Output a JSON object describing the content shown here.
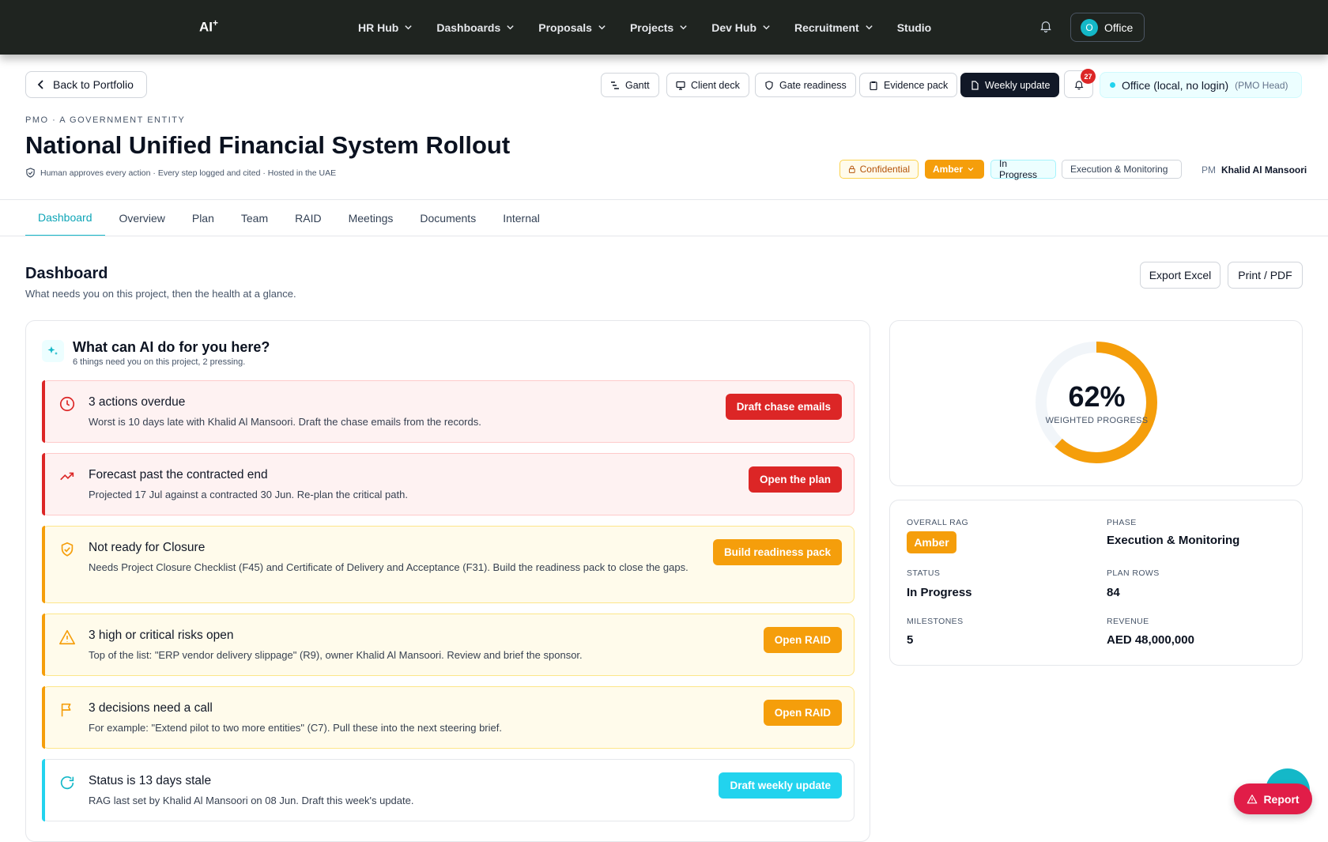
{
  "app": {
    "logo": "AI",
    "logo_sup": "+"
  },
  "nav": {
    "items": [
      {
        "label": "HR Hub",
        "dropdown": true
      },
      {
        "label": "Dashboards",
        "dropdown": true
      },
      {
        "label": "Proposals",
        "dropdown": true
      },
      {
        "label": "Projects",
        "dropdown": true
      },
      {
        "label": "Dev Hub",
        "dropdown": true
      },
      {
        "label": "Recruitment",
        "dropdown": true
      },
      {
        "label": "Studio",
        "dropdown": false
      }
    ],
    "user_initial": "O",
    "user_label": "Office"
  },
  "toolbar": {
    "back_label": "Back to Portfolio",
    "gantt": "Gantt",
    "client_deck": "Client deck",
    "gate_readiness": "Gate readiness",
    "evidence_pack": "Evidence pack",
    "weekly_update": "Weekly update",
    "notifications_count": "27",
    "office_label": "Office (local, no login)",
    "office_role": "(PMO Head)"
  },
  "project": {
    "kicker": "PMO · A GOVERNMENT ENTITY",
    "title": "National Unified Financial System Rollout",
    "subline": "Human approves every action · Every step logged and cited · Hosted in the UAE",
    "confidential": "Confidential",
    "rag": "Amber",
    "status": "In Progress",
    "phase": "Execution & Monitoring",
    "pm_label": "PM",
    "pm_name": "Khalid Al Mansoori"
  },
  "tabs": [
    "Dashboard",
    "Overview",
    "Plan",
    "Team",
    "RAID",
    "Meetings",
    "Documents",
    "Internal"
  ],
  "dashboard": {
    "title": "Dashboard",
    "subtitle": "What needs you on this project, then the health at a glance.",
    "export_excel": "Export Excel",
    "print_pdf": "Print / PDF"
  },
  "ai_panel": {
    "title": "What can AI do for you here?",
    "subtitle": "6 things need you on this project, 2 pressing.",
    "actions": [
      {
        "title": "3 actions overdue",
        "desc": "Worst is 10 days late with Khalid Al Mansoori. Draft the chase emails from the records.",
        "button": "Draft chase emails",
        "tone": "red",
        "icon": "clock-icon"
      },
      {
        "title": "Forecast past the contracted end",
        "desc": "Projected 17 Jul against a contracted 30 Jun. Re-plan the critical path.",
        "button": "Open the plan",
        "tone": "red",
        "icon": "trending-up-icon"
      },
      {
        "title": "Not ready for Closure",
        "desc": "Needs Project Closure Checklist (F45) and Certificate of Delivery and Acceptance (F31). Build the readiness pack to close the gaps.",
        "button": "Build readiness pack",
        "tone": "amber",
        "icon": "shield-check-icon"
      },
      {
        "title": "3 high or critical risks open",
        "desc": "Top of the list: \"ERP vendor delivery slippage\" (R9), owner Khalid Al Mansoori. Review and brief the sponsor.",
        "button": "Open RAID",
        "tone": "amber",
        "icon": "warning-icon"
      },
      {
        "title": "3 decisions need a call",
        "desc": "For example: \"Extend pilot to two more entities\" (C7). Pull these into the next steering brief.",
        "button": "Open RAID",
        "tone": "amber",
        "icon": "flag-icon"
      },
      {
        "title": "Status is 13 days stale",
        "desc": "RAG last set by Khalid Al Mansoori on 08 Jun. Draft this week's update.",
        "button": "Draft weekly update",
        "tone": "cyan",
        "icon": "refresh-icon"
      }
    ]
  },
  "progress": {
    "value": 62,
    "display": "62%",
    "label": "WEIGHTED PROGRESS",
    "color": "#f59e0b"
  },
  "stats": {
    "overall_rag_label": "OVERALL RAG",
    "overall_rag": "Amber",
    "phase_label": "PHASE",
    "phase": "Execution & Monitoring",
    "status_label": "STATUS",
    "status": "In Progress",
    "plan_rows_label": "PLAN ROWS",
    "plan_rows": "84",
    "milestones_label": "MILESTONES",
    "milestones": "5",
    "revenue_label": "REVENUE",
    "revenue": "AED 48,000,000"
  },
  "report_button": "Report",
  "colors": {
    "accent": "#14b8c8",
    "amber": "#f59e0b",
    "red": "#dc2626",
    "nav_bg": "#1f2420"
  }
}
